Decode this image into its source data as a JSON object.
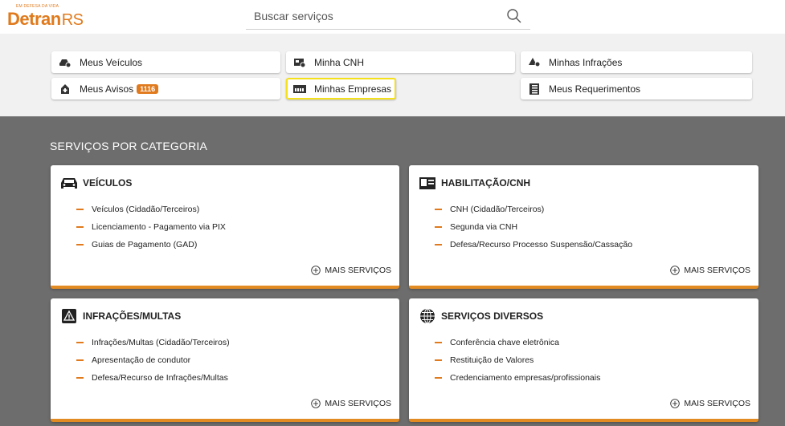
{
  "header": {
    "logo_tagline": "EM DEFESA DA VIDA",
    "logo_name": "Detran",
    "logo_suffix": "RS",
    "search_placeholder": "Buscar serviços"
  },
  "quick_links": [
    {
      "label": "Meus Veículos",
      "icon": "car-icon"
    },
    {
      "label": "Minha CNH",
      "icon": "license-icon"
    },
    {
      "label": "Minhas Infrações",
      "icon": "infraction-icon"
    },
    {
      "label": "Meus Avisos",
      "icon": "alert-icon",
      "badge": "1116"
    },
    {
      "label": "Minhas Empresas",
      "icon": "company-icon",
      "highlighted": true
    },
    {
      "label": "Meus Requerimentos",
      "icon": "requests-icon"
    }
  ],
  "section_title": "SERVIÇOS POR CATEGORIA",
  "more_label": "MAIS SERVIÇOS",
  "cards": [
    {
      "title": "VEÍCULOS",
      "icon": "car-icon",
      "items": [
        "Veículos (Cidadão/Terceiros)",
        "Licenciamento - Pagamento via PIX",
        "Guias de Pagamento (GAD)"
      ]
    },
    {
      "title": "HABILITAÇÃO/CNH",
      "icon": "license-icon",
      "items": [
        "CNH (Cidadão/Terceiros)",
        "Segunda via CNH",
        "Defesa/Recurso Processo Suspensão/Cassação"
      ]
    },
    {
      "title": "INFRAÇÕES/MULTAS",
      "icon": "warning-icon",
      "items": [
        "Infrações/Multas (Cidadão/Terceiros)",
        "Apresentação de condutor",
        "Defesa/Recurso de Infrações/Multas"
      ]
    },
    {
      "title": "SERVIÇOS DIVERSOS",
      "icon": "globe-icon",
      "items": [
        "Conferência chave eletrônica",
        "Restituição de Valores",
        "Credenciamento empresas/profissionais"
      ]
    }
  ],
  "colors": {
    "accent": "#e07a1c",
    "dark_bg": "#6d6d6d",
    "quick_bg": "#f1f1f1",
    "highlight": "#f5e11b"
  }
}
